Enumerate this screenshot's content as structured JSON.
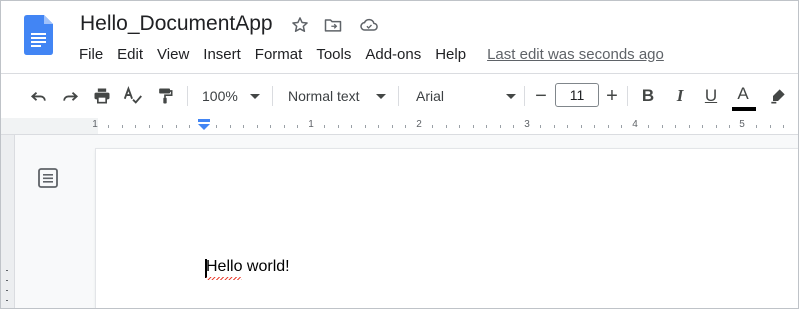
{
  "document": {
    "title": "Hello_DocumentApp",
    "body_text": "Hello world!",
    "last_edit": "Last edit was seconds ago"
  },
  "menu": [
    "File",
    "Edit",
    "View",
    "Insert",
    "Format",
    "Tools",
    "Add-ons",
    "Help"
  ],
  "toolbar": {
    "zoom": "100%",
    "style": "Normal text",
    "font": "Arial",
    "font_size": "11",
    "decrease_label": "−",
    "increase_label": "+",
    "bold_label": "B",
    "italic_label": "I",
    "underline_label": "U",
    "text_color_label": "A"
  },
  "ruler": {
    "labels": [
      "1",
      "1",
      "2",
      "3",
      "4",
      "5"
    ]
  },
  "icons": {
    "star": "star-icon",
    "move": "move-to-folder-icon",
    "cloud": "cloud-saved-icon",
    "undo": "undo-icon",
    "redo": "redo-icon",
    "print": "print-icon",
    "spellcheck": "spellcheck-icon",
    "paint_format": "paint-format-icon",
    "highlight": "highlight-icon",
    "outline": "document-outline-icon"
  },
  "colors": {
    "docs_blue": "#4285f4",
    "text_color_bar": "#000000",
    "spell_underline": "#ea4335"
  }
}
